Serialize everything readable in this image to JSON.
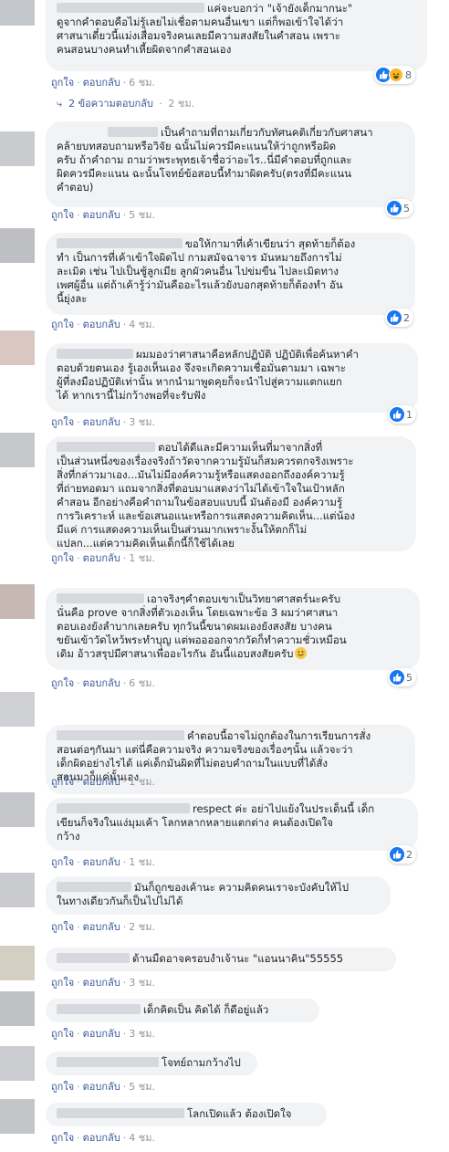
{
  "ui": {
    "like_label": "ถูกใจ",
    "reply_label": "ตอบกลับ",
    "separator": "·"
  },
  "comments": [
    {
      "text": "แค่จะบอกว่า \"เจ้ายังเด็กมากนะ\"\nดูจากคำตอบคือไม่รู้เลยไม่เชื่อตามคนอื่นเขา แต่ก็พอเข้าใจได้ว่า\nศาสนาเดี๋ยวนี้แม่งเสื่อมจริงคนเลยมีความสงสัยในคำสอน เพราะ\nคนสอนบางคนทำเหี้ยผิดจากคำสอนเอง",
      "time": "6 ชม.",
      "reactions": "8",
      "replies_label": "2 ข้อความตอบกลับ",
      "replies_time": "2 ชม."
    },
    {
      "text": "เป็นคำถามที่ถามเกี่ยวกับทัศนคติเกี่ยวกับศาสนา\nคล้ายบทสอบถามหรือวิจัย ฉนั้นไม่ควรมีคะแนนให้ว่าถูกหรือผิด\nครับ ถ้าคำถาม ถามว่าพระพุทธเจ้าชื่อว่าอะไร..นี่มีคำตอบที่ถูกและ\nผิดควรมีคะแนน ฉะนั้นโจทย์ข้อสอบนี้ทำมาผิดครับ(ตรงที่มีคะแนน\nคำตอบ)",
      "time": "5 ชม.",
      "reactions": "5"
    },
    {
      "text": "ขอให้กามาที่เค้าเขียนว่า สุดท้ายก็ต้อง\nทำ เป็นการที่เค้าเข้าใจผิดไป กามสมัจฉาจาร มันหมายถึงการไม่\nละเมิด เช่น ไปเป็นชู้ลูกเมีย ลูกผัวคนอื่น ไปข่มขืน ไปละเมิดทาง\nเพศผู้อื่น แต่ถ้าเค้ารู้ว่ามันคืออะไรแล้วยังบอกสุดท้ายก็ต้องทำ อัน\nนี้ยุ่งละ",
      "time": "4 ชม.",
      "reactions": "2"
    },
    {
      "text": "ผมมองว่าศาสนาคือหลักปฏิบัติ ปฏิบัติเพื่อค้นหาคำ\nตอบด้วยตนเอง รู้เองเห็นเอง จึงจะเกิดความเชื่อมั่นตามมา เฉพาะ\nผู้ที่ลงมือปฏิบัติเท่านั้น หากนำมาพูดคุยก็จะนำไปสู่ความแตกแยก\nได้ หากเรานี้ไม่กว้างพอที่จะรับฟัง",
      "time": "3 ชม.",
      "reactions": "1"
    },
    {
      "text": "ตอบได้ดีและมีความเห็นที่มาจากสิ่งที่\nเป็นส่วนหนึ่งของเรื่องจริงถ้าวัดจากความรู้มันก็สมควรตกจริงเพราะ\nสิ่งที่กล่าวมาเอง...มันไม่มีองค์ความรู้หรือแสดงออกถึงองค์ความรู้\nที่ถ่ายทอดมา แถมจากสิ่งที่ตอบมาแสดงว่าไม่ได้เข้าใจในเป้าหลัก\nคำสอน อีกอย่างคือคำถามในข้อสอบแบบนี้ มันต้องมี องค์ความรู้\nการวิเคราะห์ และข้อเสนอแนะหรือการแสดงความคิดเห็น...แต่น้อง\nมีแค่ การแสดงความเห็นเป็นส่วนมากเพราะงั้นให้ตกก็ไม่\nแปลก...แต่ความคิดเห็นเด็กนี้ก็ใช้ได้เลย",
      "time": "1 ชม."
    },
    {
      "text": "เอาจริงๆคำตอบเขาเป็นวิทยาศาสตร์นะครับ\nนั่นคือ prove จากสิ่งที่ตัวเองเห็น โดยเฉพาะข้อ 3 ผมว่าศาสนา\nตอบเองยังลำบากเลยครับ ทุกวันนี้ขนาดผมเองยังสงสัย บางคน\nขยันเข้าวัดไหว้พระทำบุญ แต่พออออกจากวัดก็ทำความชั่วเหมือน\nเดิม อ้าวสรุปมีศาสนาเพื่ออะไรกัน อันนี้แอบสงสัยครับ",
      "emoji": "smile",
      "time": "6 ชม.",
      "reactions": "5"
    },
    {
      "text": "คำตอบนี้อาจไม่ถูกต้องในการเรียนการสั่ง\nสอนต่อๆกันมา แต่นี่คือความจริง ความจริงของเรื่องๆนั้น แล้วจะว่า\nเด็กผิดอย่างไรได้ แค่เด็กมันผิดที่ไม่ตอบคำถามในแบบที่ได้สั่ง\nสอนมาก็แค่นั้นเอง",
      "time": "1 ชม."
    },
    {
      "text": "respect ค่ะ อย่าไปแย้งในประเด็นนี้ เด็ก\nเขียนก็จริงในแง่มุมเค้า โลกหลากหลายแตกต่าง คนต้องเปิดใจ\nกว้าง",
      "time": "1 ชม.",
      "reactions": "2"
    },
    {
      "text": "มันก็ถูกของเค้านะ ความคิดคนเราจะบังคับให้ไป\nในทางเดียวกันก็เป็นไปไม่ได้",
      "time": "2 ชม."
    },
    {
      "text": "ด้านมืดอาจครอบงำเจ้านะ \"แอนนาคิน\"55555",
      "time": "3 ชม."
    },
    {
      "text": "เด็กคิดเป็น คิดได้ ก็ดีอยู่แล้ว",
      "time": "3 ชม."
    },
    {
      "text": "โจทย์ถามกว้างไป",
      "time": "5 ชม."
    },
    {
      "text": "โลกเปิดแล้ว ต้องเปิดใจ",
      "time": "4 ชม."
    }
  ]
}
